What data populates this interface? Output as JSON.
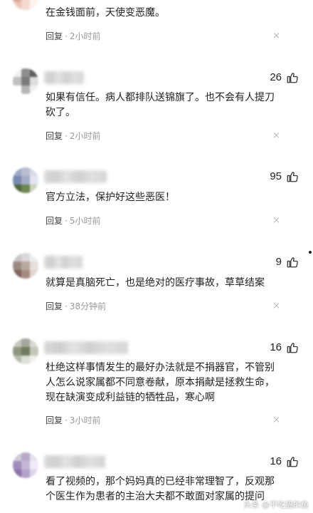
{
  "reply_label": "回复",
  "separator": "·",
  "close_glyph": "×",
  "comments": [
    {
      "text": "在金钱面前，天使变恶魔。",
      "likes": "",
      "time": "2小时前",
      "avatar_colors": [
        "#e8b8a8",
        "#f1d2c6",
        "#f6e6df",
        "#dba08c",
        "#f4ddd3",
        "#fbeee8",
        "#e9c2b4",
        "#f2dacf",
        "#fdf4f0"
      ]
    },
    {
      "text": "如果有信任。病人都排队送锦旗了。也不会有人提刀\n砍了。",
      "likes": "26",
      "time": "2小时前",
      "avatar_colors": [
        "#f0f0f0",
        "#8f8f8f",
        "#5e5e5e",
        "#c0c0c0",
        "#7a7a7a",
        "#dedede",
        "#ffffff",
        "#b5b5b5",
        "#efefef"
      ]
    },
    {
      "text": "官方立法，保护好这些恶医！",
      "likes": "95",
      "time": "5小时前",
      "avatar_colors": [
        "#9fa9c7",
        "#b7bdd2",
        "#d8dbe5",
        "#7a8ab0",
        "#a3adc8",
        "#e3e6ee",
        "#4f6a3d",
        "#6e8651",
        "#cbd3c0"
      ]
    },
    {
      "text": "就算是真脑死亡，也是绝对的医疗事故，草草结案",
      "likes": "9",
      "time": "38分钟前",
      "avatar_colors": [
        "#c8c8c8",
        "#d9d9d9",
        "#efefef",
        "#9a8a83",
        "#b8a89f",
        "#e7dfdb",
        "#7f655c",
        "#a58c82",
        "#e1d6d1"
      ]
    },
    {
      "text": "杜绝这样事情发生的最好办法就是不捐器官，不管别\n人怎么说家属都不同意卷献，原本捐献是拯救生命，\n现在缺演变成利益链的牺牲品，寒心啊",
      "likes": "16",
      "time": "3小时前",
      "avatar_colors": [
        "#c6c8c1",
        "#a3a79b",
        "#d7d9d2",
        "#8f977f",
        "#6f7a5e",
        "#c2c7b6",
        "#b8bcb0",
        "#dde0d6",
        "#eeefea"
      ]
    },
    {
      "text": "看了视频的，那个妈妈真的已经非常理智了，反观那\n个医生作为患者的主治大夫都不敢面对家属的提问",
      "likes": "16",
      "time": "",
      "avatar_colors": [
        "#d0c9d8",
        "#b6a9c7",
        "#e6e0ee",
        "#9f8cb9",
        "#c4b7d6",
        "#efeaf5",
        "#8c74a8",
        "#b3a2c9",
        "#ded5e9"
      ]
    }
  ],
  "watermark": "头条 @不吃猫的鱼",
  "icons": {
    "thumb": "thumbs-up-icon",
    "close": "close-icon"
  },
  "colors": {
    "text": "#222222",
    "meta": "#999999",
    "reply": "#444444"
  }
}
